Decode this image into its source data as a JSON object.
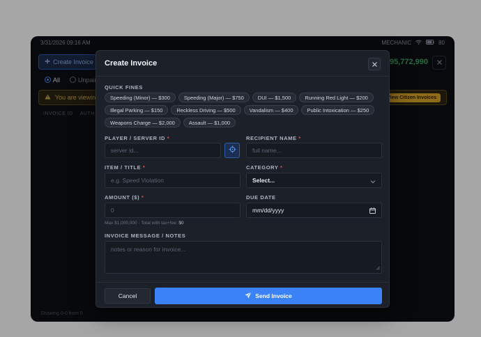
{
  "background": {
    "status_time": "3/31/2026 09:16 AM",
    "job_label": "MECHANIC",
    "battery_label": "80",
    "create_button_label": "Create Invoice",
    "total_amount": "$95,772,990",
    "filters": [
      {
        "label": "All",
        "selected": true
      },
      {
        "label": "Unpaid",
        "selected": false
      }
    ],
    "warning_text": "You are viewing",
    "warning_button_label": "View Citizen Invoices",
    "table_headers": [
      "INVOICE ID",
      "AUTH"
    ],
    "footer_text": "Showing 0-0 from 0"
  },
  "modal": {
    "title": "Create Invoice",
    "quick_fines_label": "QUICK FINES",
    "quick_fines_rows": [
      [
        "Speeding (Minor) — $300",
        "Speeding (Major) — $750",
        "DUI — $1,500",
        "Running Red Light — $200"
      ],
      [
        "Illegal Parking — $150",
        "Reckless Driving — $500",
        "Vandalism — $400",
        "Public Intoxication — $250"
      ],
      [
        "Weapons Charge — $2,000",
        "Assault — $1,000"
      ]
    ],
    "player_label": "PLAYER / SERVER ID",
    "player_placeholder": "server id...",
    "recipient_label": "RECIPIENT NAME",
    "recipient_placeholder": "full name...",
    "item_label": "ITEM / TITLE",
    "item_placeholder": "e.g. Speed Violation",
    "category_label": "CATEGORY",
    "category_value": "Select...",
    "amount_label": "AMOUNT ($)",
    "amount_placeholder": "0",
    "due_label": "DUE DATE",
    "due_value": "mm/dd/yyyy",
    "hint_prefix": "Max $1,000,000 · Total with tax+fee:",
    "hint_total": "$0",
    "notes_label": "INVOICE MESSAGE / NOTES",
    "notes_placeholder": "notes or reason for invoice...",
    "required_mark": "*",
    "cancel_label": "Cancel",
    "send_label": "Send Invoice"
  },
  "colors": {
    "accent": "#3b82f6",
    "required": "#e05353",
    "warning": "#d9a527",
    "total_green": "#3fa566"
  },
  "icons": [
    "plus-icon",
    "wifi-icon",
    "battery-icon",
    "close-icon",
    "warning-icon",
    "crosshair-icon",
    "chevron-down-icon",
    "calendar-icon",
    "send-icon",
    "resize-icon"
  ]
}
